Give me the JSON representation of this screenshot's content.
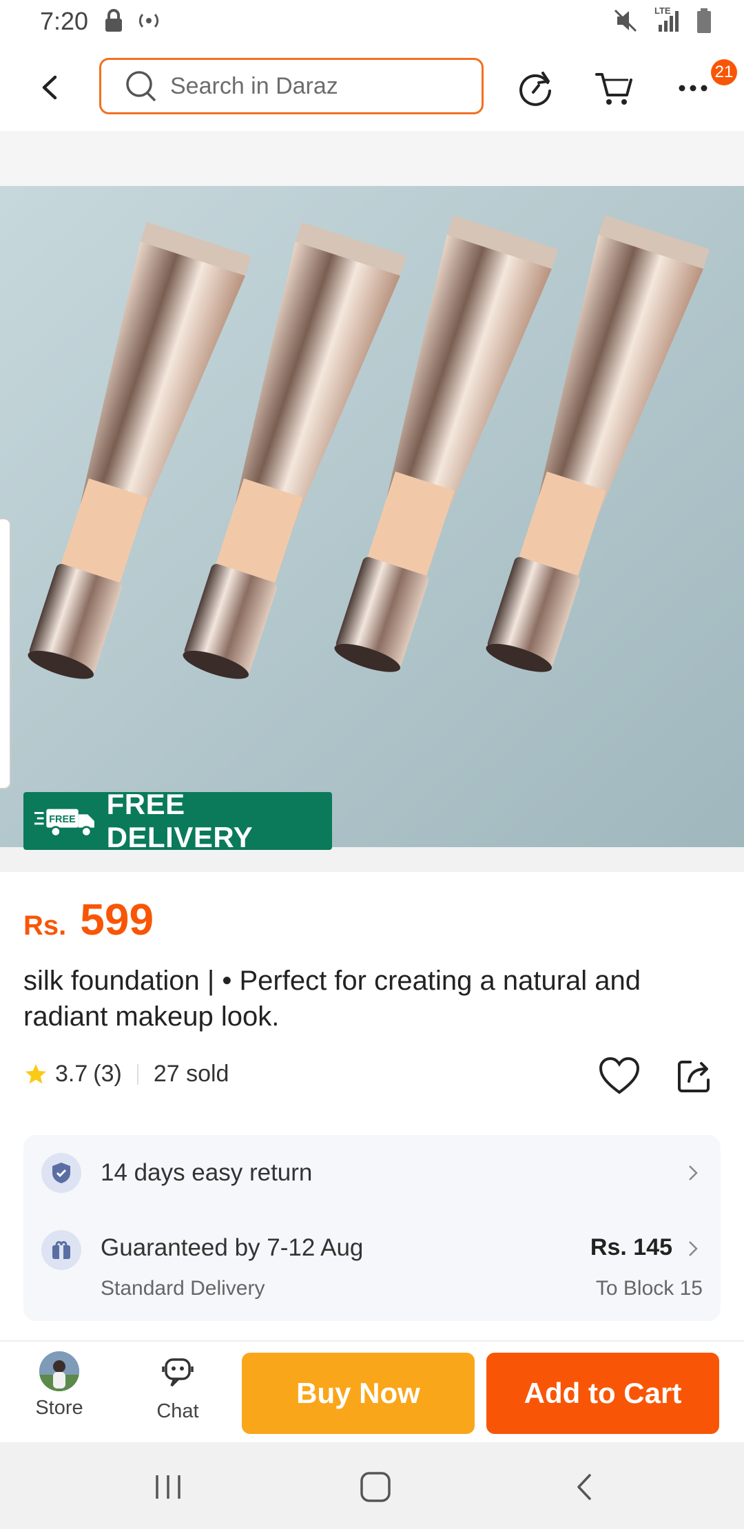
{
  "status_bar": {
    "time": "7:20",
    "network_label": "LTE",
    "icons": [
      "lock-icon",
      "hotspot-icon",
      "mute-icon",
      "signal-icon",
      "battery-icon"
    ]
  },
  "header": {
    "search_placeholder": "Search in Daraz",
    "notification_count": "21",
    "icons": [
      "back-icon",
      "search-icon",
      "refresh-icon",
      "cart-icon",
      "more-icon"
    ]
  },
  "product": {
    "free_delivery_badge": "FREE DELIVERY",
    "free_badge_small": "FREE",
    "currency": "Rs.",
    "price": "599",
    "title": "silk foundation | • Perfect for creating a natural and radiant makeup look.",
    "rating": "3.7",
    "rating_count": "(3)",
    "sold": "27 sold"
  },
  "services": {
    "return_text": "14 days easy return",
    "delivery_text": "Guaranteed by 7-12 Aug",
    "delivery_type": "Standard Delivery",
    "delivery_price": "Rs. 145",
    "delivery_location": "To Block 15"
  },
  "actions": {
    "store_label": "Store",
    "chat_label": "Chat",
    "buy_now": "Buy Now",
    "add_to_cart": "Add to Cart"
  },
  "colors": {
    "accent": "#f85606",
    "buy_now": "#faa61a",
    "free_delivery": "#0a7a5a"
  }
}
